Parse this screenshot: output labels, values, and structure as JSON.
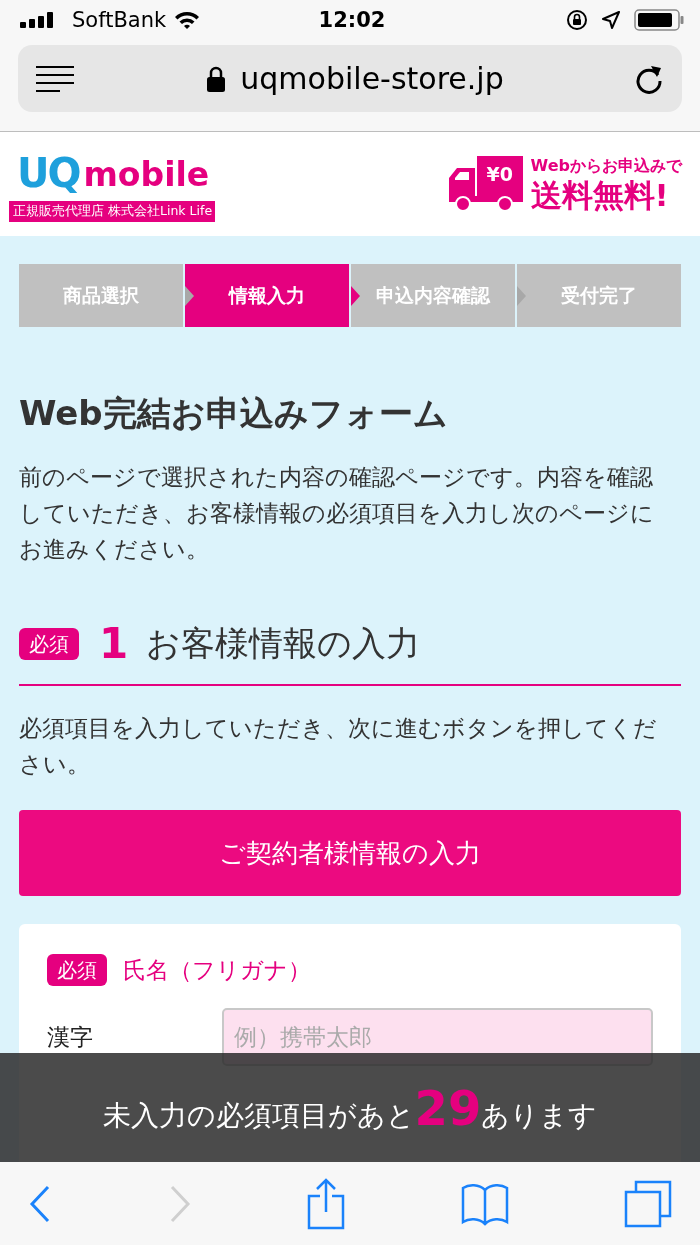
{
  "status_bar": {
    "carrier": "SoftBank",
    "time": "12:02"
  },
  "browser": {
    "url": "uqmobile-store.jp"
  },
  "header": {
    "logo_word_1": "UQ",
    "logo_word_2": "mobile",
    "logo_tagline": "正規販売代理店 株式会社Link Life",
    "truck_price": "¥0",
    "promo_line_1": "Webからお申込みで",
    "promo_line_2": "送料無料!"
  },
  "steps": [
    {
      "label": "商品選択",
      "selected": false
    },
    {
      "label": "情報入力",
      "selected": true
    },
    {
      "label": "申込内容確認",
      "selected": false
    },
    {
      "label": "受付完了",
      "selected": false
    }
  ],
  "title": "Web完結お申込みフォーム",
  "intro": "前のページで選択された内容の確認ページです。内容を確認していただき、お客様情報の必須項目を入力し次のページにお進みください。",
  "section": {
    "badge": "必須",
    "number": "1",
    "heading": "お客様情報の入力",
    "instruction": "必須項目を入力していただき、次に進むボタンを押してください。",
    "button": "ご契約者様情報の入力"
  },
  "form_card": {
    "badge": "必須",
    "heading": "氏名（フリガナ）",
    "fields": [
      {
        "label": "漢字",
        "placeholder": "例）携帯太郎"
      }
    ]
  },
  "notice": {
    "before": "未入力の必須項目があと",
    "count": "29",
    "after": "あります"
  },
  "toolbar": [
    {
      "kind": "back",
      "disabled": false
    },
    {
      "kind": "forward",
      "disabled": true
    },
    {
      "kind": "share",
      "disabled": false
    },
    {
      "kind": "bookmarks",
      "disabled": false
    },
    {
      "kind": "tabs",
      "disabled": false
    }
  ]
}
